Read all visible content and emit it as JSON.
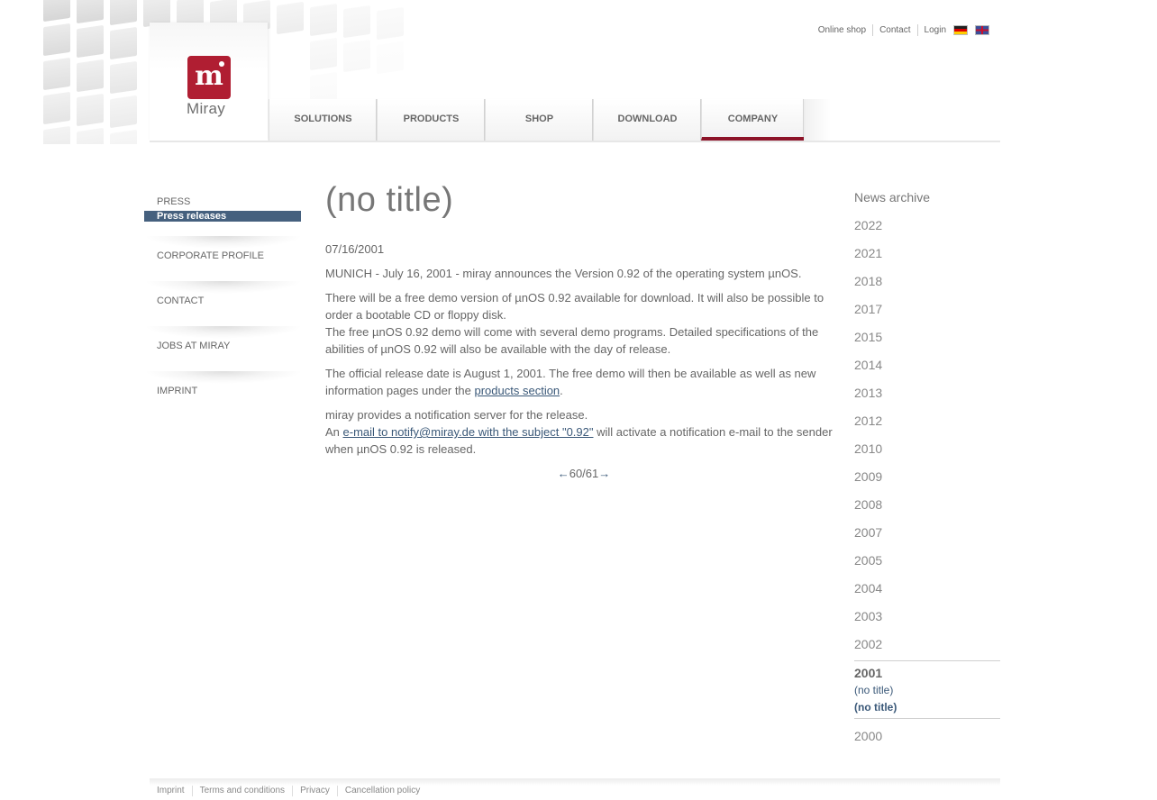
{
  "brand": {
    "logo_text": "Miray",
    "logo_mark": "m",
    "accent": "#8c1328",
    "logo_color": "#b01e32"
  },
  "top_links": [
    "Online shop",
    "Contact",
    "Login"
  ],
  "languages": [
    "de-flag-icon",
    "en-flag-icon"
  ],
  "nav": [
    {
      "label": "SOLUTIONS",
      "active": false
    },
    {
      "label": "PRODUCTS",
      "active": false
    },
    {
      "label": "SHOP",
      "active": false
    },
    {
      "label": "DOWNLOAD",
      "active": false
    },
    {
      "label": "COMPANY",
      "active": true
    }
  ],
  "sidebar": {
    "press": "PRESS",
    "press_releases": "Press releases",
    "corporate_profile": "CORPORATE PROFILE",
    "contact": "CONTACT",
    "jobs": "JOBS AT MIRAY",
    "imprint": "IMPRINT"
  },
  "article": {
    "title": "(no title)",
    "date": "07/16/2001",
    "p1": "MUNICH - July 16, 2001 - miray announces the Version 0.92 of the operating system µnOS.",
    "p2a": "There will be a free demo version of µnOS 0.92 available for download. It will also be possible to order a bootable CD or floppy disk.",
    "p2b": "The free µnOS 0.92 demo will come with several demo programs. Detailed specifications of the abilities of µnOS 0.92 will also be available with the day of release.",
    "p3_pre": "The official release date is August 1, 2001. The free demo will then be available as well as new information pages under the ",
    "p3_link": "products section",
    "p3_post": ".",
    "p4a": "miray provides a notification server for the release.",
    "p4b_pre": "An ",
    "p4b_link": "e-mail to notify@miray.de with the subject \"0.92\"",
    "p4b_post": " will activate a notification e-mail to the sender when µnOS 0.92 is released.",
    "pager_prev": "←",
    "pager_text": "60/61",
    "pager_next": "→"
  },
  "archive": {
    "title": "News archive",
    "years_before": [
      "2022",
      "2021",
      "2018",
      "2017",
      "2015",
      "2014",
      "2013",
      "2012",
      "2010",
      "2009",
      "2008",
      "2007",
      "2005",
      "2004",
      "2003",
      "2002"
    ],
    "active_year": "2001",
    "active_entries": [
      "(no title)",
      "(no title)"
    ],
    "years_after": [
      "2000"
    ]
  },
  "footer": [
    "Imprint",
    "Terms and conditions",
    "Privacy",
    "Cancellation policy"
  ]
}
